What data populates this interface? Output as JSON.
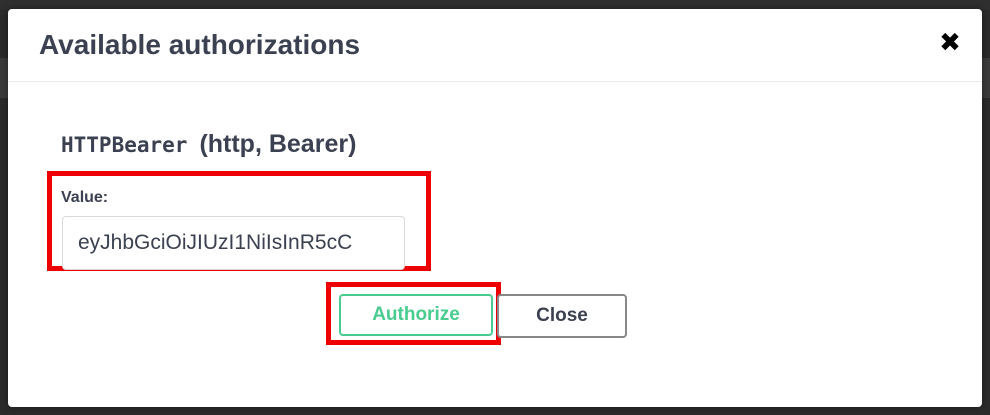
{
  "modal": {
    "title": "Available authorizations",
    "close_icon": "close-icon",
    "close_glyph": "✖"
  },
  "auth": {
    "name": "HTTPBearer",
    "type": "(http, Bearer)",
    "value_label": "Value:",
    "value": "eyJhbGciOiJIUzI1NiIsInR5cC"
  },
  "buttons": {
    "authorize_label": "Authorize",
    "close_label": "Close"
  },
  "colors": {
    "highlight": "#ee0000",
    "authorize": "#49cc90",
    "text": "#3b4151"
  }
}
